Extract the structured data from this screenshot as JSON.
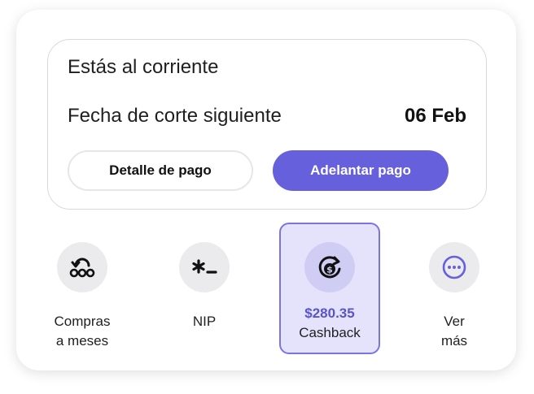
{
  "status": {
    "title": "Estás al corriente",
    "cut_label": "Fecha de corte siguiente",
    "cut_date": "06 Feb",
    "detail_button": "Detalle de pago",
    "advance_button": "Adelantar pago"
  },
  "shortcuts": [
    {
      "label": "Compras\na meses",
      "icon": "installments-icon"
    },
    {
      "label": "NIP",
      "icon": "pin-icon"
    },
    {
      "amount": "$280.35",
      "label": "Cashback",
      "icon": "cashback-icon",
      "selected": true
    },
    {
      "label": "Ver\nmás",
      "icon": "more-icon"
    }
  ],
  "colors": {
    "primary": "#6760dc",
    "selected_bg": "#e4e3fb",
    "selected_border": "#7a74e2",
    "amount_text": "#5a54c8"
  }
}
